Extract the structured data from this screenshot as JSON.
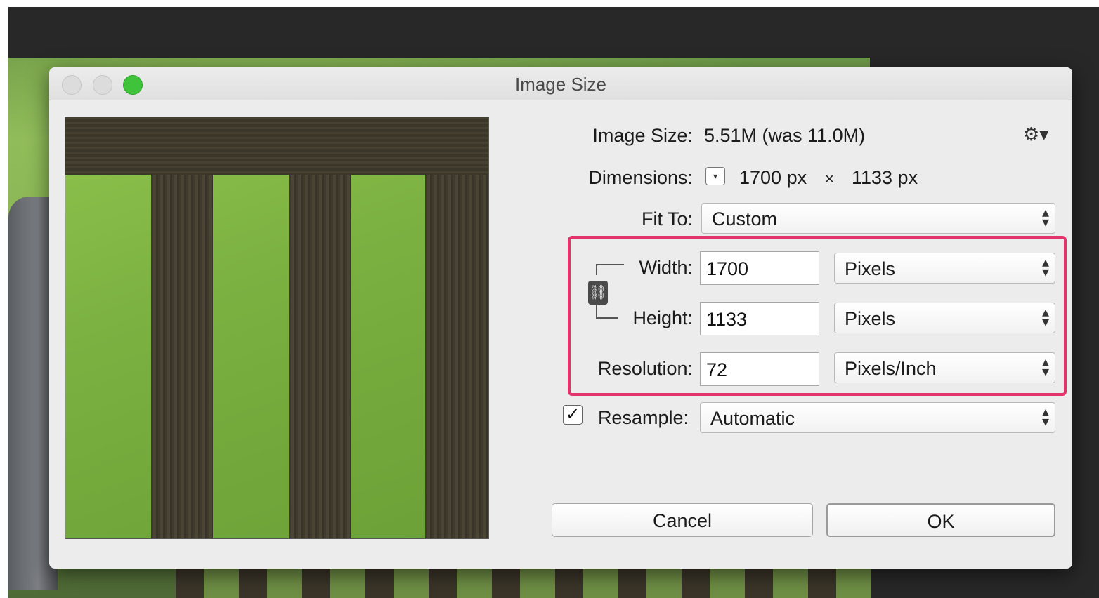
{
  "dialog": {
    "title": "Image Size",
    "image_size_label": "Image Size:",
    "image_size_value": "5.51M (was 11.0M)",
    "dimensions_label": "Dimensions:",
    "dimensions_width": "1700 px",
    "dimensions_times": "×",
    "dimensions_height": "1133 px",
    "fit_to_label": "Fit To:",
    "fit_to_value": "Custom",
    "width_label": "Width:",
    "width_value": "1700",
    "width_unit": "Pixels",
    "height_label": "Height:",
    "height_value": "1133",
    "height_unit": "Pixels",
    "resolution_label": "Resolution:",
    "resolution_value": "72",
    "resolution_unit": "Pixels/Inch",
    "resample_label": "Resample:",
    "resample_checked": true,
    "resample_value": "Automatic",
    "cancel_label": "Cancel",
    "ok_label": "OK"
  },
  "icons": {
    "gear": "gear-icon",
    "link": "constrain-proportions-link-icon",
    "dimensions_toggle": "dimensions-unit-dropdown-icon"
  },
  "colors": {
    "highlight_box": "#e2336b",
    "zoom_button": "#3fc33a"
  }
}
